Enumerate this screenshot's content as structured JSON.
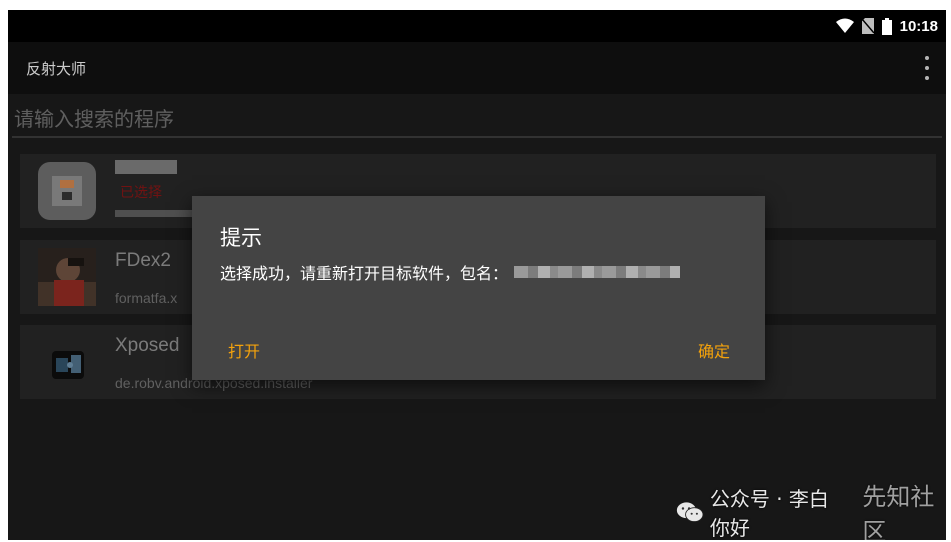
{
  "status_bar": {
    "time": "10:18"
  },
  "app_bar": {
    "title": "反射大师"
  },
  "search": {
    "placeholder": "请输入搜索的程序"
  },
  "app_list": [
    {
      "name": "",
      "package": "",
      "tag": "已选择",
      "icon": "blurred-app-icon"
    },
    {
      "name": "FDex2",
      "package": "formatfa.x",
      "icon": "photo-app-icon"
    },
    {
      "name": "Xposed",
      "package": "de.robv.android.xposed.installer",
      "icon": "xposed-puzzle-icon"
    }
  ],
  "dialog": {
    "title": "提示",
    "message": "选择成功，请重新打开目标软件，包名：",
    "open_label": "打开",
    "confirm_label": "确定"
  },
  "watermark": {
    "account": "公众号 · 李白你好",
    "site": "先知社区"
  },
  "colors": {
    "accent": "#f4a20c",
    "dialog_bg": "#444444",
    "screen_bg": "#1b1b1b",
    "tag_red": "#a01010"
  }
}
